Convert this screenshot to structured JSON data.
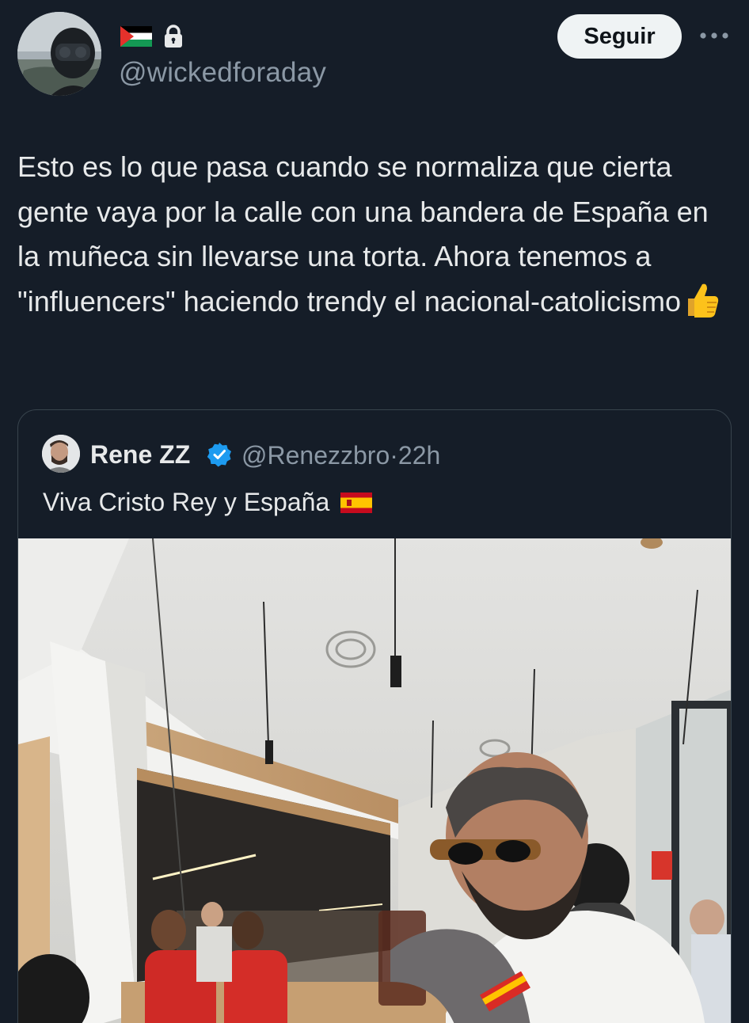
{
  "post": {
    "handle": "@wickedforaday",
    "badges": [
      "palestine-flag-icon",
      "lock-icon"
    ],
    "follow_label": "Seguir",
    "more_icon": "more-dots-icon",
    "text": "Esto es lo que pasa cuando se normaliza que cierta gente vaya por la calle con una bandera de España en la muñeca sin llevarse una torta. Ahora tenemos a \"influencers\" haciendo trendy el nacional-catolicismo",
    "emoji": "thumbs-up-icon"
  },
  "quote": {
    "name": "Rene ZZ",
    "verified_icon": "verified-badge-icon",
    "handle": "@Renezzbro",
    "separator": "·",
    "time": "22h",
    "text": "Viva Cristo Rey y España",
    "flag": "spain-flag-icon"
  },
  "colors": {
    "background": "#151d28",
    "text": "#e7e9ea",
    "muted": "#8b98a5",
    "border": "#38444d",
    "follow_bg": "#eff3f4",
    "verified": "#1d9bf0"
  }
}
